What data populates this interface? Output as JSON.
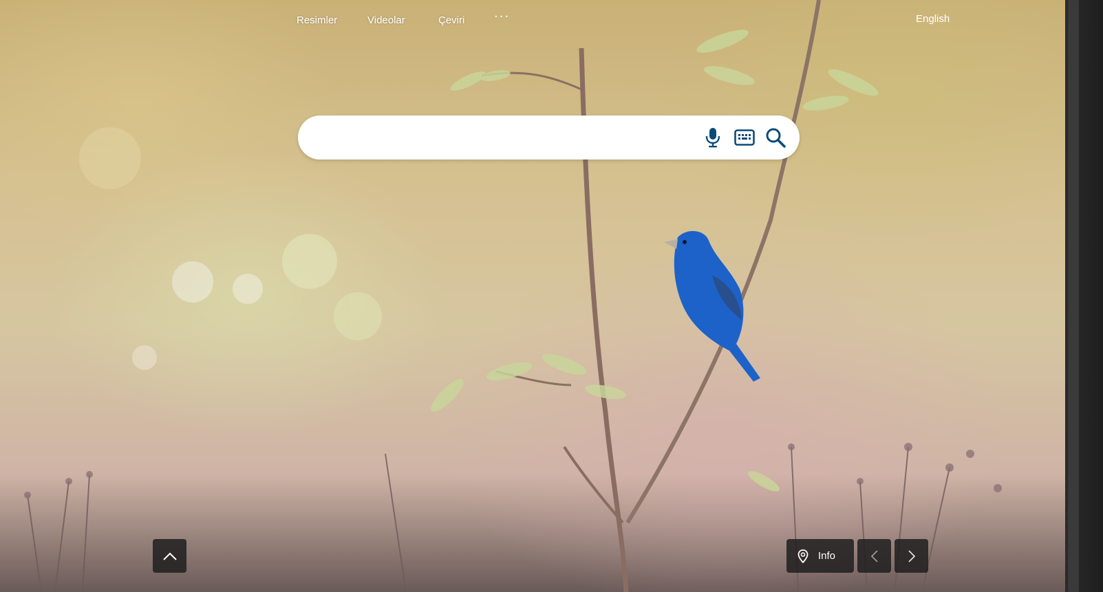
{
  "nav": {
    "items": [
      {
        "label": "Resimler"
      },
      {
        "label": "Videolar"
      },
      {
        "label": "Çeviri"
      }
    ],
    "more_label": "···"
  },
  "language_link": "English",
  "search": {
    "placeholder": "",
    "value": ""
  },
  "icons": {
    "mic": "microphone-icon",
    "keyboard": "keyboard-icon",
    "search": "search-icon",
    "up": "chevron-up-icon",
    "pin": "location-pin-icon",
    "prev": "chevron-left-icon",
    "next": "chevron-right-icon"
  },
  "colors": {
    "search_icon": "#0c4a78",
    "button_bg": "#1e1e1e"
  },
  "footer": {
    "info_label": "Info"
  }
}
